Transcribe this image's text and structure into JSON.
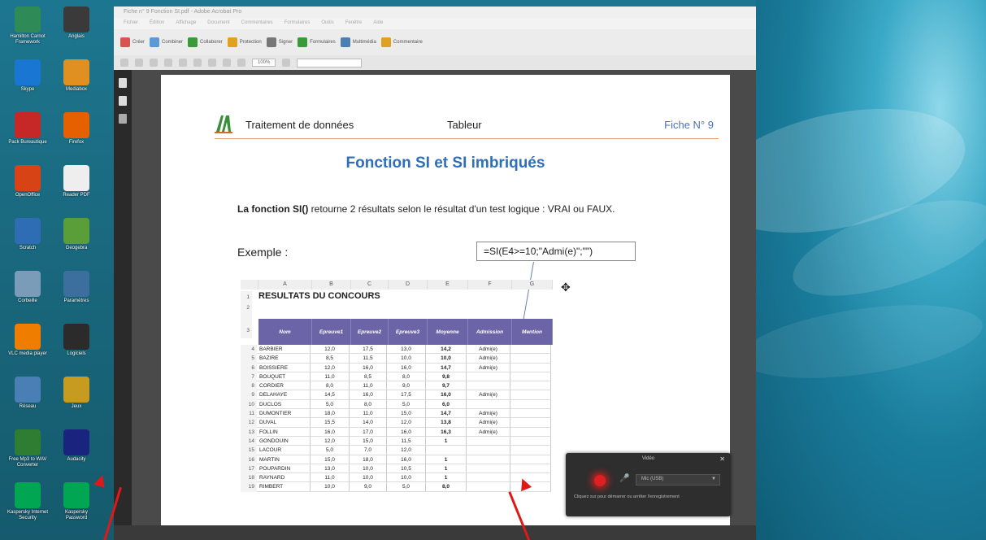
{
  "window": {
    "title": "Fiche n° 9 Fonction SI.pdf - Adobe Acrobat Pro",
    "menu": [
      "Fichier",
      "Édition",
      "Affichage",
      "Document",
      "Commentaires",
      "Formulaires",
      "Outils",
      "Fenêtre",
      "Aide"
    ],
    "toolbar": [
      "Créer",
      "Combiner",
      "Collaborer",
      "Protection",
      "Signer",
      "Formulaires",
      "Multimédia",
      "Commentaire"
    ],
    "zoom": "100%"
  },
  "document": {
    "header_title": "Traitement de données",
    "header_subject": "Tableur",
    "header_fiche": "Fiche N° 9",
    "main_title": "Fonction SI et SI imbriqués",
    "intro_bold": "La fonction SI()",
    "intro_rest": " retourne 2 résultats selon le résultat d'un test logique : VRAI ou FAUX.",
    "exemple_label": "Exemple :",
    "formula": "=SI(E4>=10;\"Admi(e)\";\"\")"
  },
  "sheet": {
    "col_headers": [
      "A",
      "B",
      "C",
      "D",
      "E",
      "F",
      "G"
    ],
    "title": "RESULTATS DU CONCOURS",
    "table_headers": [
      "Nom",
      "Epreuve1",
      "Epreuve2",
      "Epreuve3",
      "Moyenne",
      "Admission",
      "Mention"
    ],
    "rows": [
      {
        "n": "4",
        "cells": [
          "BARBIER",
          "12,0",
          "17,5",
          "13,0",
          "14,2",
          "Admi(e)",
          ""
        ]
      },
      {
        "n": "5",
        "cells": [
          "BAZIRE",
          "8,5",
          "11,5",
          "10,0",
          "10,0",
          "Admi(e)",
          ""
        ]
      },
      {
        "n": "6",
        "cells": [
          "BOISSIERE",
          "12,0",
          "16,0",
          "16,0",
          "14,7",
          "Admi(e)",
          ""
        ]
      },
      {
        "n": "7",
        "cells": [
          "BOUQUET",
          "11,0",
          "8,5",
          "8,0",
          "9,8",
          "",
          ""
        ]
      },
      {
        "n": "8",
        "cells": [
          "CORDIER",
          "8,0",
          "11,0",
          "9,0",
          "9,7",
          "",
          ""
        ]
      },
      {
        "n": "9",
        "cells": [
          "DELAHAYE",
          "14,5",
          "16,0",
          "17,5",
          "16,0",
          "Admi(e)",
          ""
        ]
      },
      {
        "n": "10",
        "cells": [
          "DUCLOS",
          "5,0",
          "8,0",
          "5,0",
          "6,0",
          "",
          ""
        ]
      },
      {
        "n": "11",
        "cells": [
          "DUMONTIER",
          "18,0",
          "11,0",
          "15,0",
          "14,7",
          "Admi(e)",
          ""
        ]
      },
      {
        "n": "12",
        "cells": [
          "DUVAL",
          "15,5",
          "14,0",
          "12,0",
          "13,8",
          "Admi(e)",
          ""
        ]
      },
      {
        "n": "13",
        "cells": [
          "FOLLIN",
          "16,0",
          "17,0",
          "16,0",
          "16,3",
          "Admi(e)",
          ""
        ]
      },
      {
        "n": "14",
        "cells": [
          "GONDOUIN",
          "12,0",
          "15,0",
          "11,5",
          "1",
          "",
          ""
        ]
      },
      {
        "n": "15",
        "cells": [
          "LACOUR",
          "5,0",
          "7,0",
          "12,0",
          "",
          "",
          ""
        ]
      },
      {
        "n": "16",
        "cells": [
          "MARTIN",
          "15,0",
          "18,0",
          "16,0",
          "1",
          "",
          ""
        ]
      },
      {
        "n": "17",
        "cells": [
          "POUPARDIN",
          "13,0",
          "10,0",
          "10,5",
          "1",
          "",
          ""
        ]
      },
      {
        "n": "18",
        "cells": [
          "RAYNARD",
          "11,0",
          "10,0",
          "10,0",
          "1",
          "",
          ""
        ]
      },
      {
        "n": "19",
        "cells": [
          "RIMBERT",
          "10,0",
          "9,0",
          "5,0",
          "8,0",
          "",
          ""
        ]
      }
    ]
  },
  "recorder": {
    "title": "Vidéo",
    "device": "Mic (USB)",
    "hint": "Cliquez sur pour démarrer ou arrêter l'enregistrement"
  },
  "desktop": {
    "icons": [
      {
        "label": "Hamilton Carnot Framework",
        "icon": "app-icon",
        "color": "#2e8b57"
      },
      {
        "label": "Anglais",
        "icon": "font-icon",
        "color": "#3a3a3a"
      },
      {
        "label": "Skype",
        "icon": "app-icon",
        "color": "#1976d2"
      },
      {
        "label": "Mediabox",
        "icon": "app-icon",
        "color": "#e09020"
      },
      {
        "label": "Pack Bureautique",
        "icon": "app-icon",
        "color": "#c62828"
      },
      {
        "label": "Firefox",
        "icon": "firefox-icon",
        "color": "#e66000"
      },
      {
        "label": "OpenOffice",
        "icon": "app-icon",
        "color": "#d84315"
      },
      {
        "label": "Reader PDF",
        "icon": "pdf-icon",
        "color": "#eeeeee"
      },
      {
        "label": "Scratch",
        "icon": "app-icon",
        "color": "#2e6db4"
      },
      {
        "label": "Geogebra",
        "icon": "app-icon",
        "color": "#5a9e3a"
      },
      {
        "label": "Corbeille",
        "icon": "trash-icon",
        "color": "#7a9cb8"
      },
      {
        "label": "Paramètres",
        "icon": "gear-icon",
        "color": "#3d6f9e"
      },
      {
        "label": "VLC media player",
        "icon": "vlc-icon",
        "color": "#ef7d00"
      },
      {
        "label": "Logiciels",
        "icon": "app-icon",
        "color": "#2b2b2b"
      },
      {
        "label": "Réseau",
        "icon": "app-icon",
        "color": "#4a7fb5"
      },
      {
        "label": "Jeux",
        "icon": "app-icon",
        "color": "#c79a20"
      },
      {
        "label": "Free Mp3 to WAV Converter",
        "icon": "app-icon",
        "color": "#2e7d32"
      },
      {
        "label": "Audacity",
        "icon": "audacity-icon",
        "color": "#1a237e"
      },
      {
        "label": "Kaspersky Internet Security",
        "icon": "app-icon",
        "color": "#00a651"
      },
      {
        "label": "Kaspersky Password",
        "icon": "app-icon",
        "color": "#00a651"
      }
    ]
  }
}
